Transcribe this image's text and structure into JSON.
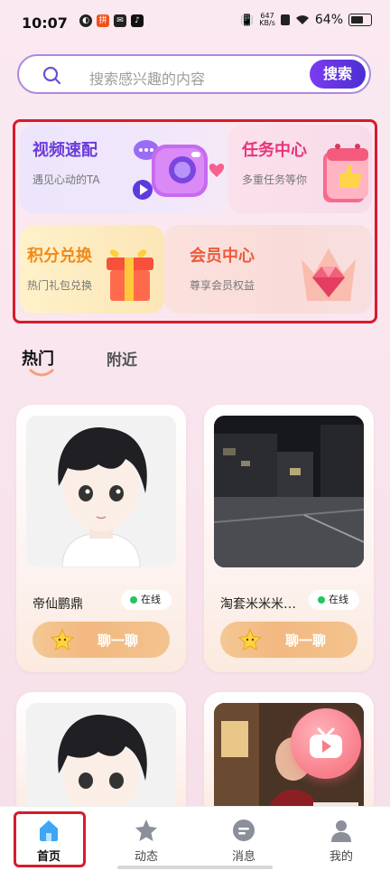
{
  "status_bar": {
    "time": "10:07",
    "net_speed_value": "647",
    "net_speed_unit": "KB/s",
    "battery": "64%"
  },
  "search": {
    "placeholder": "搜索感兴趣的内容",
    "button_label": "搜索"
  },
  "features": {
    "video_match": {
      "title": "视频速配",
      "subtitle": "遇见心动的TA"
    },
    "task_center": {
      "title": "任务中心",
      "subtitle": "多重任务等你"
    },
    "points_exchange": {
      "title": "积分兑换",
      "subtitle": "热门礼包兑换"
    },
    "vip_center": {
      "title": "会员中心",
      "subtitle": "尊享会员权益"
    }
  },
  "tabs": {
    "hot": "热门",
    "nearby": "附近"
  },
  "users": [
    {
      "name": "帝仙鹏鼎",
      "status": "在线",
      "chat_label": "聊一聊"
    },
    {
      "name": "淘套米米米…",
      "status": "在线",
      "chat_label": "聊一聊"
    }
  ],
  "nav": {
    "home": "首页",
    "feed": "动态",
    "messages": "消息",
    "mine": "我的"
  },
  "colors": {
    "accent_purple": "#6a35e6",
    "online_green": "#22c55e",
    "highlight_red": "#d81b2b",
    "active_nav_blue": "#3ea6f5"
  }
}
